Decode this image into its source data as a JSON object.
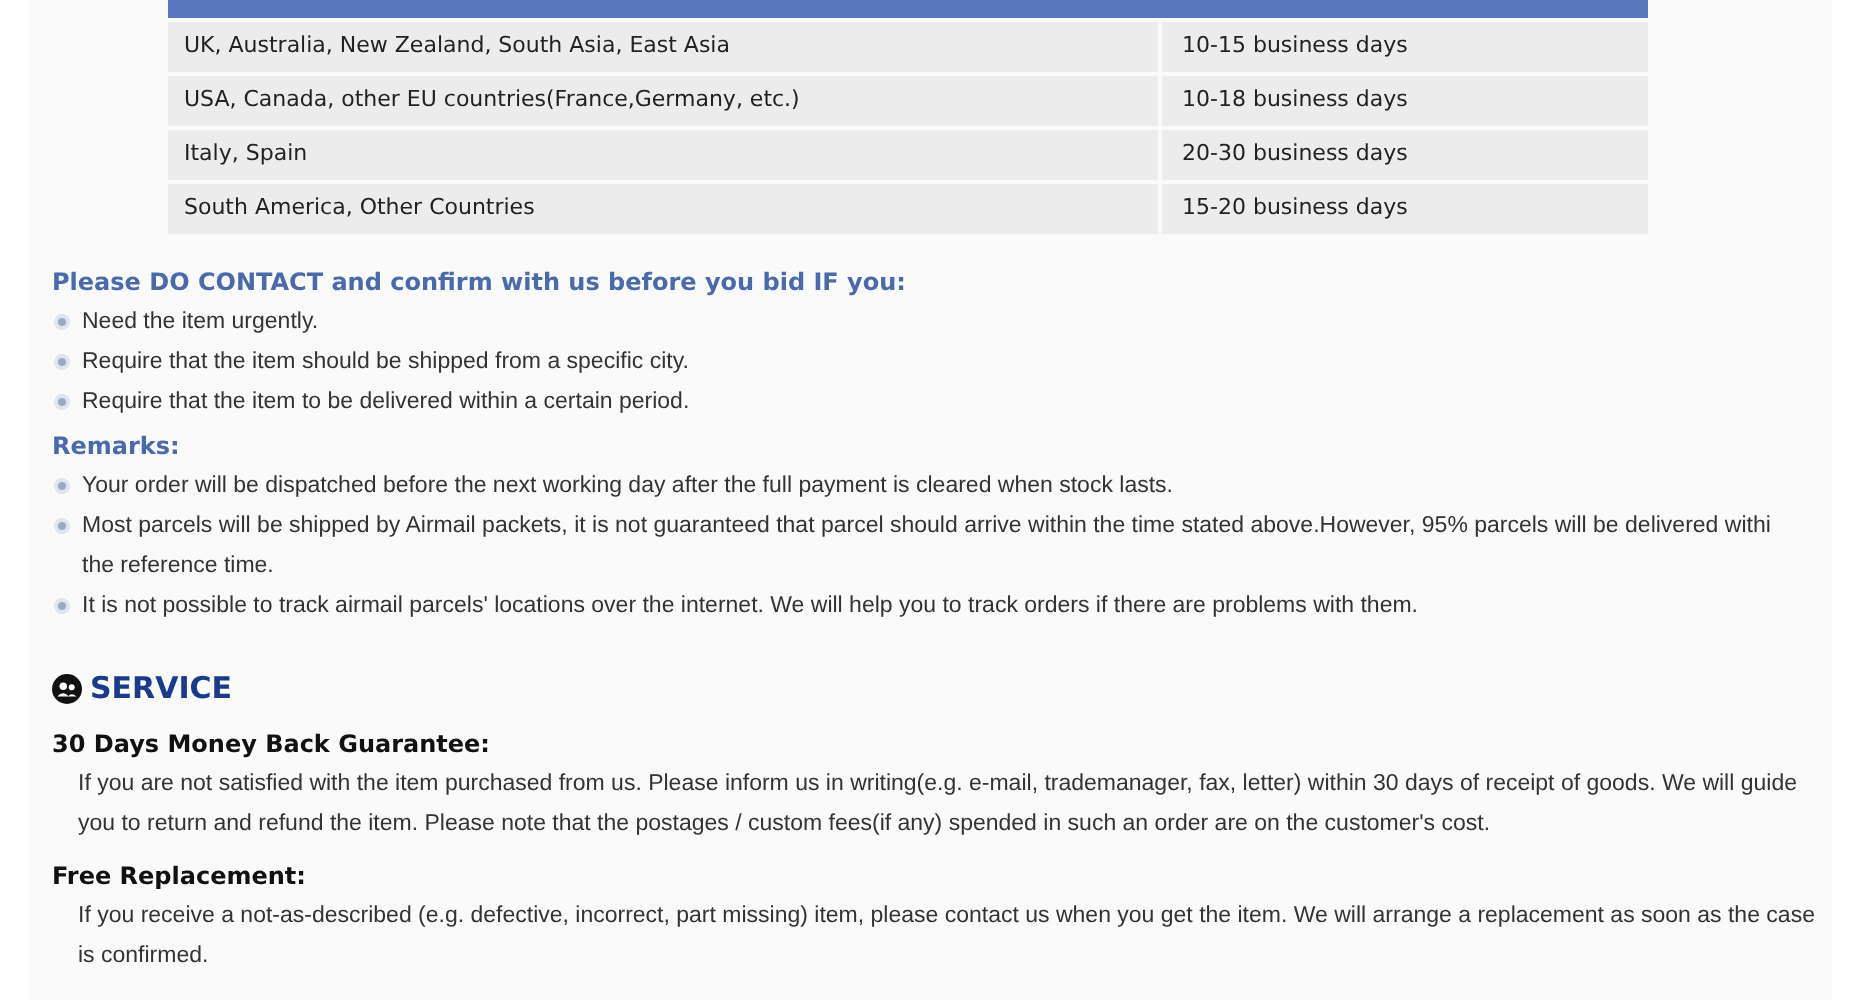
{
  "delivery_table": {
    "rows": [
      {
        "region": "UK, Australia, New Zealand, South Asia, East Asia",
        "time": "10-15 business days"
      },
      {
        "region": "USA, Canada, other EU countries(France,Germany, etc.)",
        "time": "10-18 business days"
      },
      {
        "region": "Italy, Spain",
        "time": "20-30 business days"
      },
      {
        "region": "South America, Other Countries",
        "time": "15-20 business days"
      }
    ]
  },
  "contact": {
    "heading": "Please DO CONTACT and confirm with us before you bid IF you:",
    "items": [
      {
        "lines": [
          "Need the item urgently."
        ]
      },
      {
        "lines": [
          "Require that the item should be shipped from a specific city."
        ]
      },
      {
        "lines": [
          "Require that the item to be delivered within a certain period."
        ]
      }
    ]
  },
  "remarks": {
    "heading": "Remarks:",
    "items": [
      {
        "lines": [
          "Your order will be dispatched before the next working day after the full payment is cleared when stock lasts."
        ]
      },
      {
        "lines": [
          "Most parcels will be shipped by Airmail packets, it is not guaranteed that parcel should arrive within the time stated above.However, 95% parcels will be delivered withi",
          "the reference time."
        ]
      },
      {
        "lines": [
          "It is not possible to track airmail parcels' locations over the internet. We will help you to track orders if there are problems with them."
        ]
      }
    ]
  },
  "service": {
    "title": "SERVICE",
    "sections": [
      {
        "heading": "30 Days Money Back Guarantee:",
        "text": "If you are not satisfied with the item purchased from us. Please inform us in writing(e.g. e-mail, trademanager, fax, letter) within 30 days of receipt of goods. We will guide you to return and refund the item. Please note that the postages / custom fees(if any) spended in such an order are on the customer's cost."
      },
      {
        "heading": "Free Replacement:",
        "text": "If you receive a not-as-described (e.g. defective, incorrect, part missing) item, please contact us when you get the item. We will arrange a replacement as soon as the case is confirmed."
      }
    ]
  }
}
